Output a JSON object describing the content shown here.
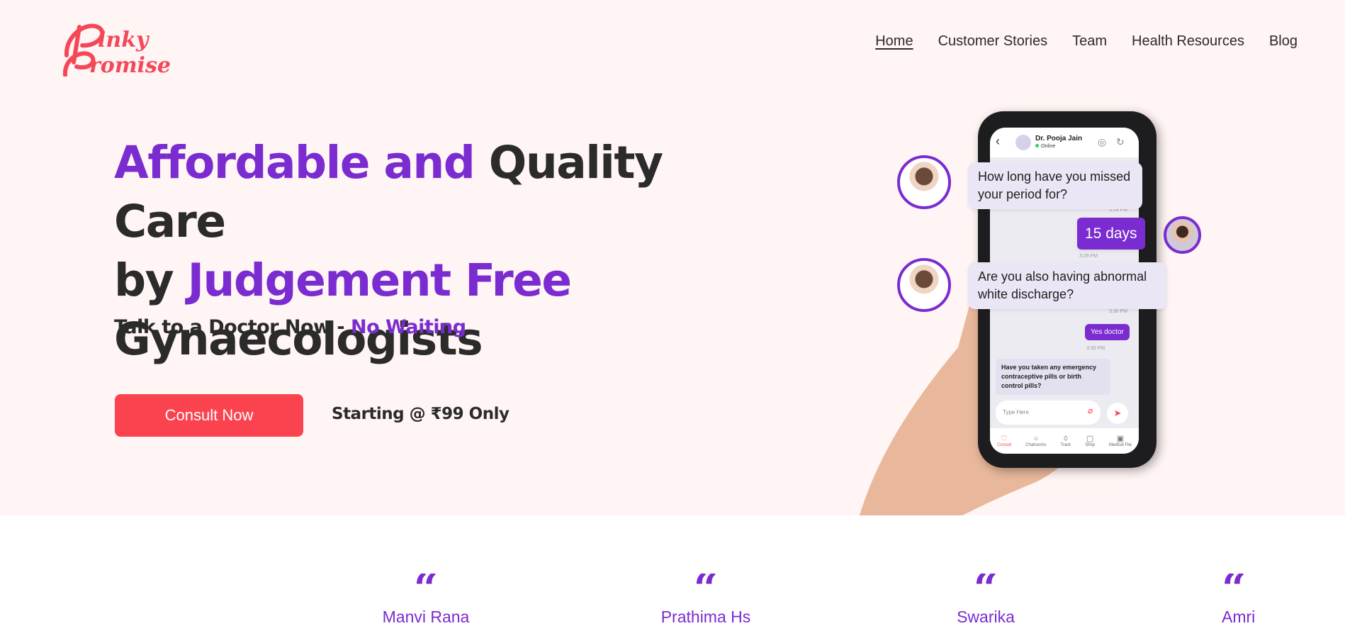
{
  "brand": {
    "logo_text": "Pinky Promise",
    "accent": "#7b2cd0",
    "cta": "#fb4350",
    "bg": "#fff5f4"
  },
  "nav": [
    {
      "label": "Home",
      "active": true
    },
    {
      "label": "Customer Stories",
      "active": false
    },
    {
      "label": "Team",
      "active": false
    },
    {
      "label": "Health Resources",
      "active": false
    },
    {
      "label": "Blog",
      "active": false
    }
  ],
  "hero": {
    "headline": {
      "part1": "Affordable and",
      "part2": " Quality Care",
      "part3": "by ",
      "part4": "Judgement Free",
      "part5": "Gynaecologists"
    },
    "subline": {
      "text": "Talk to a Doctor Now - ",
      "highlight": "No Waiting"
    },
    "cta_label": "Consult Now",
    "price_text": "Starting @ ₹99 Only"
  },
  "chat": {
    "doctor_name": "Dr. Pooja Jain",
    "status": "Online",
    "bubble1": "How long have you missed your period for?",
    "bubble2": "Are you also having abnormal white discharge?",
    "reply1": "15 days",
    "reply2": "Yes doctor",
    "time1": "3:28 PM",
    "time2": "3:29 PM",
    "time3": "3:30 PM",
    "time4": "3:30 PM",
    "question": "Have you taken any emergency contraceptive pills or birth control pills?",
    "input_placeholder": "Type Here",
    "tabs": [
      {
        "label": "Consult",
        "icon": "stethoscope-icon"
      },
      {
        "label": "Chatrooms",
        "icon": "chat-icon"
      },
      {
        "label": "Track",
        "icon": "drop-icon"
      },
      {
        "label": "Shop",
        "icon": "bag-icon"
      },
      {
        "label": "Medical File",
        "icon": "file-icon"
      }
    ]
  },
  "testimonials": [
    {
      "name": "Manvi Rana"
    },
    {
      "name": "Prathima Hs"
    },
    {
      "name": "Swarika"
    },
    {
      "name": "Amri"
    }
  ]
}
